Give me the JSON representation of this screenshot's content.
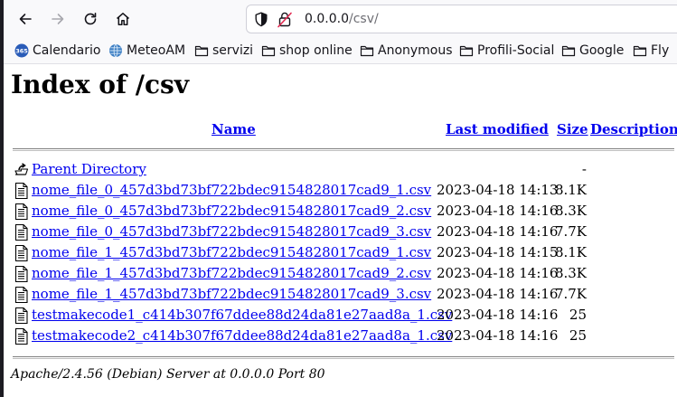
{
  "browser": {
    "url_host": "0.0.0.0",
    "url_path": "/csv/"
  },
  "bookmarks": [
    {
      "label": "Calendario",
      "icon": "calendar-365-icon"
    },
    {
      "label": "MeteoAM",
      "icon": "globe-icon"
    },
    {
      "label": "servizi",
      "icon": "folder-icon"
    },
    {
      "label": "shop online",
      "icon": "folder-icon"
    },
    {
      "label": "Anonymous",
      "icon": "folder-icon"
    },
    {
      "label": "Profili-Social",
      "icon": "folder-icon"
    },
    {
      "label": "Google",
      "icon": "folder-icon"
    },
    {
      "label": "Fly",
      "icon": "folder-icon"
    }
  ],
  "page": {
    "title": "Index of /csv",
    "columns": {
      "name": "Name",
      "last_modified": "Last modified",
      "size": "Size",
      "description": "Description"
    },
    "parent": {
      "name": "Parent Directory",
      "date": "",
      "size": "-"
    },
    "files": [
      {
        "name": "nome_file_0_457d3bd73bf722bdec9154828017cad9_1.csv",
        "date": "2023-04-18 14:13",
        "size": "8.1K"
      },
      {
        "name": "nome_file_0_457d3bd73bf722bdec9154828017cad9_2.csv",
        "date": "2023-04-18 14:16",
        "size": "8.3K"
      },
      {
        "name": "nome_file_0_457d3bd73bf722bdec9154828017cad9_3.csv",
        "date": "2023-04-18 14:16",
        "size": "7.7K"
      },
      {
        "name": "nome_file_1_457d3bd73bf722bdec9154828017cad9_1.csv",
        "date": "2023-04-18 14:15",
        "size": "8.1K"
      },
      {
        "name": "nome_file_1_457d3bd73bf722bdec9154828017cad9_2.csv",
        "date": "2023-04-18 14:16",
        "size": "8.3K"
      },
      {
        "name": "nome_file_1_457d3bd73bf722bdec9154828017cad9_3.csv",
        "date": "2023-04-18 14:16",
        "size": "7.7K"
      },
      {
        "name": "testmakecode1_c414b307f67ddee88d24da81e27aad8a_1.csv",
        "date": "2023-04-18 14:16",
        "size": "25"
      },
      {
        "name": "testmakecode2_c414b307f67ddee88d24da81e27aad8a_1.csv",
        "date": "2023-04-18 14:16",
        "size": "25"
      }
    ],
    "footer": "Apache/2.4.56 (Debian) Server at 0.0.0.0 Port 80"
  }
}
